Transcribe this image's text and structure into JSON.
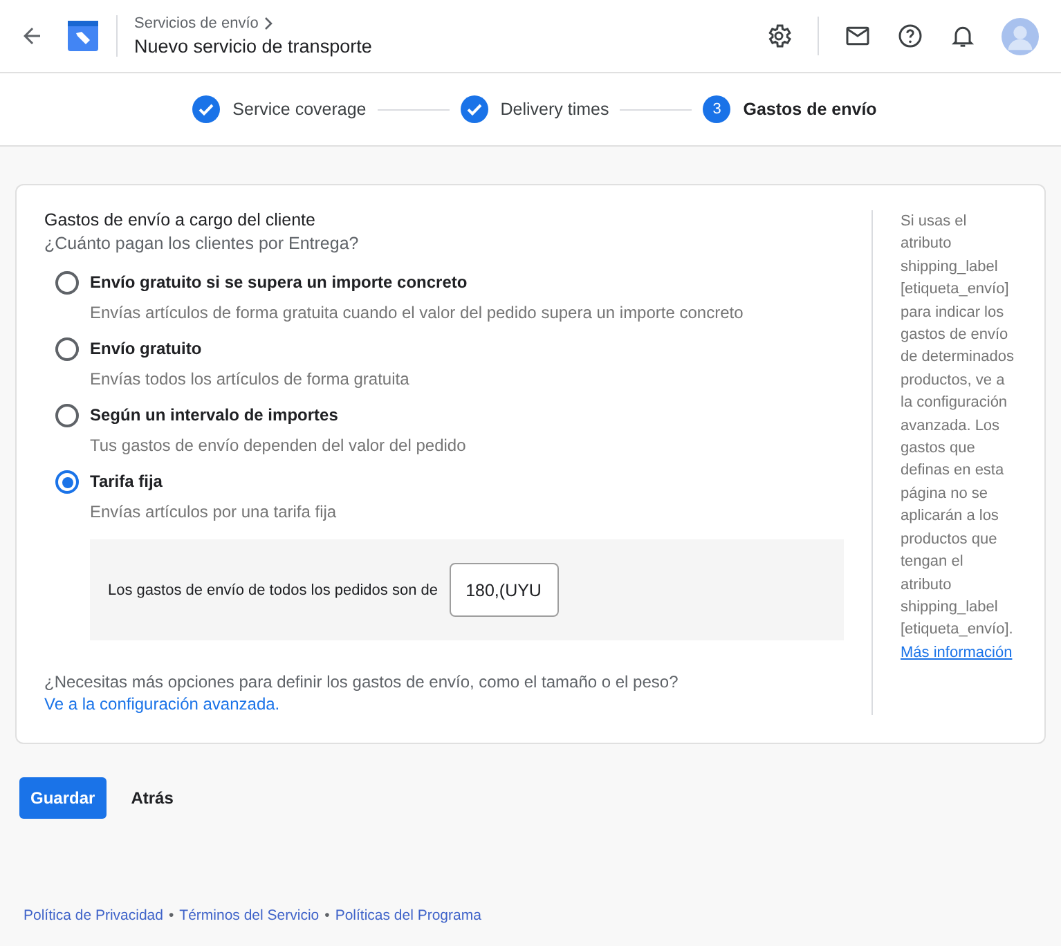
{
  "header": {
    "breadcrumb": "Servicios de envío",
    "title": "Nuevo servicio de transporte"
  },
  "stepper": [
    {
      "label": "Service coverage",
      "done": true
    },
    {
      "label": "Delivery times",
      "done": true
    },
    {
      "label": "Gastos de envío",
      "done": false,
      "number": "3"
    }
  ],
  "form": {
    "heading": "Gastos de envío a cargo del cliente",
    "question": "¿Cuánto pagan los clientes por Entrega?",
    "options": [
      {
        "label": "Envío gratuito si se supera un importe concreto",
        "description": "Envías artículos de forma gratuita cuando el valor del pedido supera un importe concreto",
        "selected": false
      },
      {
        "label": "Envío gratuito",
        "description": "Envías todos los artículos de forma gratuita",
        "selected": false
      },
      {
        "label": "Según un intervalo de importes",
        "description": "Tus gastos de envío dependen del valor del pedido",
        "selected": false
      },
      {
        "label": "Tarifa fija",
        "description": "Envías artículos por una tarifa fija",
        "selected": true
      }
    ],
    "rate": {
      "label": "Los gastos de envío de todos los pedidos son de",
      "value": "180,(",
      "currency": "UYU"
    },
    "more": {
      "text": "¿Necesitas más opciones para definir los gastos de envío, como el tamaño o el peso?",
      "link": "Ve a la configuración avanzada."
    }
  },
  "aside": {
    "text": "Si usas el atributo shipping_label [etiqueta_envío] para indicar los gastos de envío de determinados productos, ve a la configuración avanzada. Los gastos que definas en esta página no se aplicarán a los productos que tengan el atributo shipping_label [etiqueta_envío].",
    "link": "Más información"
  },
  "buttons": [
    {
      "label": "Guardar",
      "kind": "primary"
    },
    {
      "label": "Atrás",
      "kind": "text"
    }
  ],
  "footer": {
    "separator": "•",
    "links": [
      "Política de Privacidad",
      "Términos del Servicio",
      "Políticas del Programa"
    ]
  }
}
